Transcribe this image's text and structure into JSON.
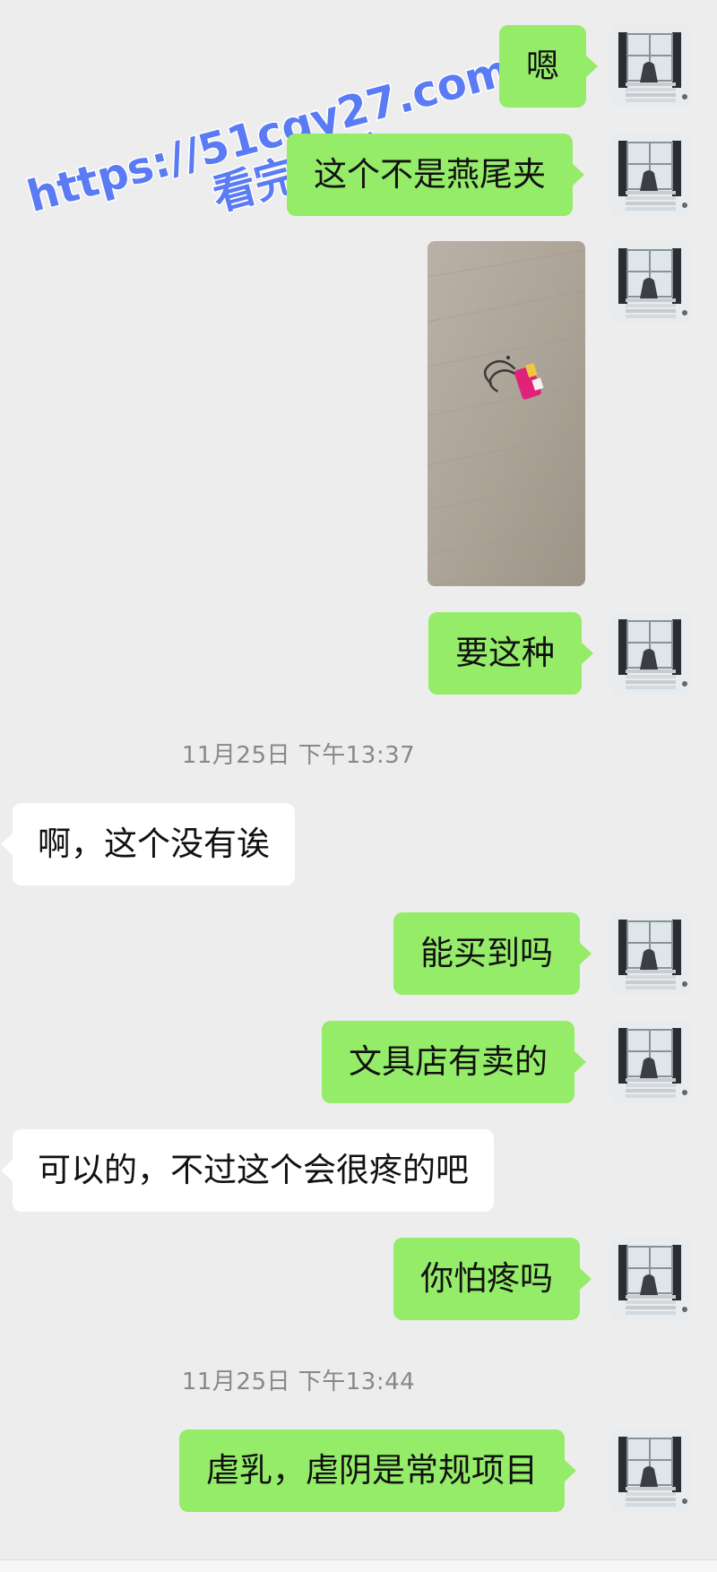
{
  "watermark": {
    "url": "https://51cgy27.com",
    "caption": "看完整版",
    "color": "#5b7bf5"
  },
  "colors": {
    "background": "#ededed",
    "outgoing_bubble": "#95ec69",
    "incoming_bubble": "#ffffff",
    "timestamp_text": "#888888"
  },
  "messages": [
    {
      "side": "out",
      "text": "嗯"
    },
    {
      "side": "out",
      "text": "这个不是燕尾夹"
    },
    {
      "side": "out",
      "type": "image",
      "image_desc": "binder-clip-photo"
    },
    {
      "side": "out",
      "text": "要这种"
    },
    {
      "type": "timestamp",
      "text": "11月25日 下午13:37"
    },
    {
      "side": "in",
      "text": "啊，这个没有诶"
    },
    {
      "side": "out",
      "text": "能买到吗"
    },
    {
      "side": "out",
      "text": "文具店有卖的"
    },
    {
      "side": "in",
      "text": "可以的，不过这个会很疼的吧"
    },
    {
      "side": "out",
      "text": "你怕疼吗"
    },
    {
      "type": "timestamp",
      "text": "11月25日 下午13:44"
    },
    {
      "side": "out",
      "text": "虐乳，虐阴是常规项目"
    }
  ]
}
